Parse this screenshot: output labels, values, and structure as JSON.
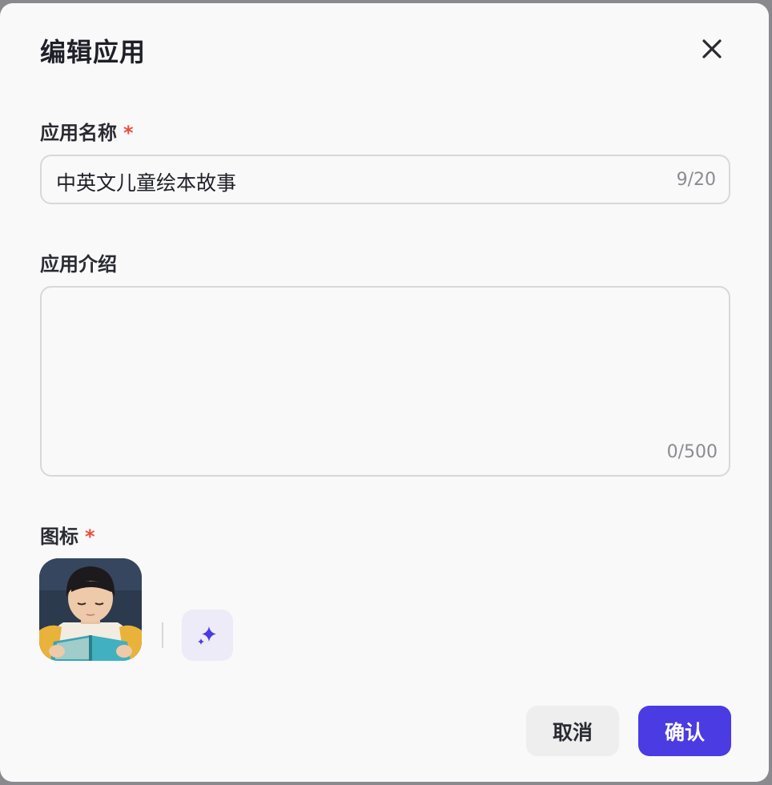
{
  "dialog": {
    "title": "编辑应用"
  },
  "fields": {
    "name": {
      "label": "应用名称",
      "required_mark": "*",
      "value": "中英文儿童绘本故事",
      "counter": "9/20"
    },
    "description": {
      "label": "应用介绍",
      "value": "",
      "counter": "0/500"
    },
    "icon": {
      "label": "图标",
      "required_mark": "*"
    }
  },
  "footer": {
    "cancel_label": "取消",
    "confirm_label": "确认"
  },
  "colors": {
    "accent": "#4a3be3",
    "required": "#ef4b3c"
  }
}
